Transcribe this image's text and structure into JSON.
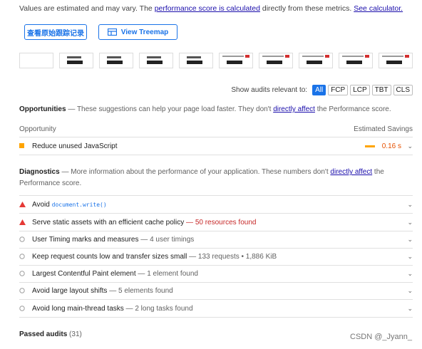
{
  "intro": {
    "prefix": "Values are estimated and may vary. The ",
    "link1": "performance score is calculated",
    "middle": " directly from these metrics. ",
    "link2": "See calculator."
  },
  "buttons": {
    "original_trace": "查看原始跟踪记录",
    "treemap": "View Treemap"
  },
  "filter": {
    "label": "Show audits relevant to:",
    "options": [
      "All",
      "FCP",
      "LCP",
      "TBT",
      "CLS"
    ]
  },
  "opportunities": {
    "title": "Opportunities",
    "desc_pre": " — These suggestions can help your page load faster. They don't ",
    "desc_link": "directly affect",
    "desc_post": " the Performance score.",
    "col_opportunity": "Opportunity",
    "col_savings": "Estimated Savings",
    "items": [
      {
        "title": "Reduce unused JavaScript",
        "savings": "0.16 s"
      }
    ]
  },
  "diagnostics": {
    "title": "Diagnostics",
    "desc_pre": " — More information about the performance of your application. These numbers don't ",
    "desc_link": "directly affect",
    "desc_post": " the",
    "desc_line2": "Performance score.",
    "items": [
      {
        "title": "Avoid ",
        "code": "document.write()",
        "detail": "",
        "level": "fail"
      },
      {
        "title": "Serve static assets with an efficient cache policy",
        "detail": "50 resources found",
        "level": "fail"
      },
      {
        "title": "User Timing marks and measures",
        "detail": "4 user timings",
        "level": "info"
      },
      {
        "title": "Keep request counts low and transfer sizes small",
        "detail": "133 requests • 1,886 KiB",
        "level": "info"
      },
      {
        "title": "Largest Contentful Paint element",
        "detail": "1 element found",
        "level": "info"
      },
      {
        "title": "Avoid large layout shifts",
        "detail": "5 elements found",
        "level": "info"
      },
      {
        "title": "Avoid long main-thread tasks",
        "detail": "2 long tasks found",
        "level": "info"
      }
    ]
  },
  "passed": {
    "label": "Passed audits",
    "count": "(31)"
  },
  "watermark": "CSDN @_Jyann_",
  "colors": {
    "accent": "#1a73e8",
    "fail": "#e53935",
    "average": "#ffa400"
  }
}
